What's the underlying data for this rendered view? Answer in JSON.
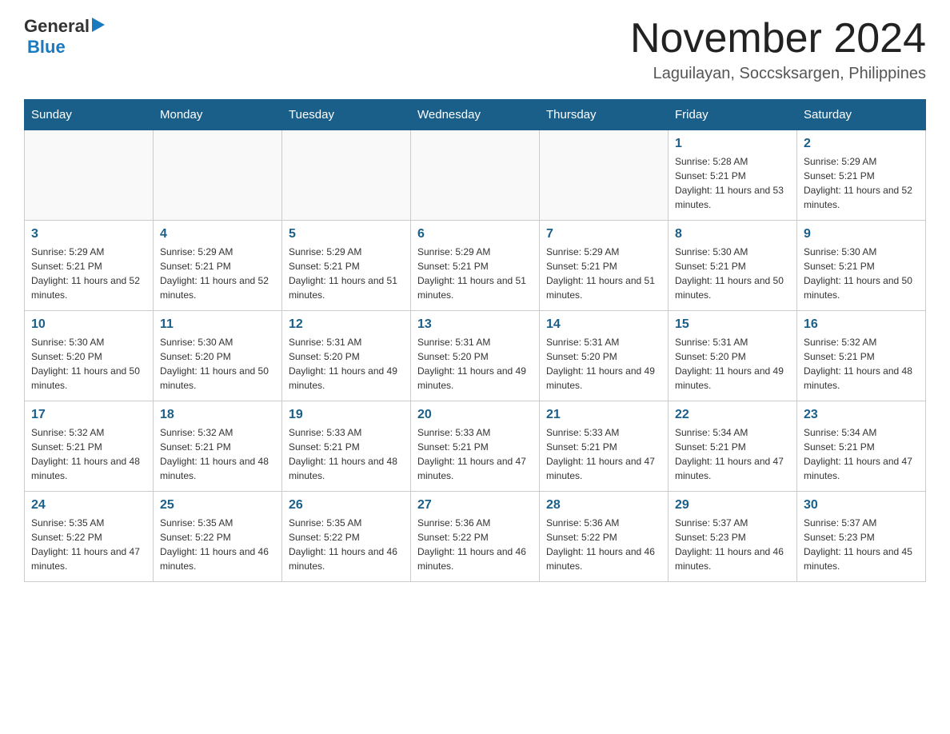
{
  "header": {
    "logo": {
      "general": "General",
      "blue": "Blue"
    },
    "title": "November 2024",
    "location": "Laguilayan, Soccsksargen, Philippines"
  },
  "calendar": {
    "days_of_week": [
      "Sunday",
      "Monday",
      "Tuesday",
      "Wednesday",
      "Thursday",
      "Friday",
      "Saturday"
    ],
    "weeks": [
      [
        {
          "day": "",
          "info": ""
        },
        {
          "day": "",
          "info": ""
        },
        {
          "day": "",
          "info": ""
        },
        {
          "day": "",
          "info": ""
        },
        {
          "day": "",
          "info": ""
        },
        {
          "day": "1",
          "info": "Sunrise: 5:28 AM\nSunset: 5:21 PM\nDaylight: 11 hours and 53 minutes."
        },
        {
          "day": "2",
          "info": "Sunrise: 5:29 AM\nSunset: 5:21 PM\nDaylight: 11 hours and 52 minutes."
        }
      ],
      [
        {
          "day": "3",
          "info": "Sunrise: 5:29 AM\nSunset: 5:21 PM\nDaylight: 11 hours and 52 minutes."
        },
        {
          "day": "4",
          "info": "Sunrise: 5:29 AM\nSunset: 5:21 PM\nDaylight: 11 hours and 52 minutes."
        },
        {
          "day": "5",
          "info": "Sunrise: 5:29 AM\nSunset: 5:21 PM\nDaylight: 11 hours and 51 minutes."
        },
        {
          "day": "6",
          "info": "Sunrise: 5:29 AM\nSunset: 5:21 PM\nDaylight: 11 hours and 51 minutes."
        },
        {
          "day": "7",
          "info": "Sunrise: 5:29 AM\nSunset: 5:21 PM\nDaylight: 11 hours and 51 minutes."
        },
        {
          "day": "8",
          "info": "Sunrise: 5:30 AM\nSunset: 5:21 PM\nDaylight: 11 hours and 50 minutes."
        },
        {
          "day": "9",
          "info": "Sunrise: 5:30 AM\nSunset: 5:21 PM\nDaylight: 11 hours and 50 minutes."
        }
      ],
      [
        {
          "day": "10",
          "info": "Sunrise: 5:30 AM\nSunset: 5:20 PM\nDaylight: 11 hours and 50 minutes."
        },
        {
          "day": "11",
          "info": "Sunrise: 5:30 AM\nSunset: 5:20 PM\nDaylight: 11 hours and 50 minutes."
        },
        {
          "day": "12",
          "info": "Sunrise: 5:31 AM\nSunset: 5:20 PM\nDaylight: 11 hours and 49 minutes."
        },
        {
          "day": "13",
          "info": "Sunrise: 5:31 AM\nSunset: 5:20 PM\nDaylight: 11 hours and 49 minutes."
        },
        {
          "day": "14",
          "info": "Sunrise: 5:31 AM\nSunset: 5:20 PM\nDaylight: 11 hours and 49 minutes."
        },
        {
          "day": "15",
          "info": "Sunrise: 5:31 AM\nSunset: 5:20 PM\nDaylight: 11 hours and 49 minutes."
        },
        {
          "day": "16",
          "info": "Sunrise: 5:32 AM\nSunset: 5:21 PM\nDaylight: 11 hours and 48 minutes."
        }
      ],
      [
        {
          "day": "17",
          "info": "Sunrise: 5:32 AM\nSunset: 5:21 PM\nDaylight: 11 hours and 48 minutes."
        },
        {
          "day": "18",
          "info": "Sunrise: 5:32 AM\nSunset: 5:21 PM\nDaylight: 11 hours and 48 minutes."
        },
        {
          "day": "19",
          "info": "Sunrise: 5:33 AM\nSunset: 5:21 PM\nDaylight: 11 hours and 48 minutes."
        },
        {
          "day": "20",
          "info": "Sunrise: 5:33 AM\nSunset: 5:21 PM\nDaylight: 11 hours and 47 minutes."
        },
        {
          "day": "21",
          "info": "Sunrise: 5:33 AM\nSunset: 5:21 PM\nDaylight: 11 hours and 47 minutes."
        },
        {
          "day": "22",
          "info": "Sunrise: 5:34 AM\nSunset: 5:21 PM\nDaylight: 11 hours and 47 minutes."
        },
        {
          "day": "23",
          "info": "Sunrise: 5:34 AM\nSunset: 5:21 PM\nDaylight: 11 hours and 47 minutes."
        }
      ],
      [
        {
          "day": "24",
          "info": "Sunrise: 5:35 AM\nSunset: 5:22 PM\nDaylight: 11 hours and 47 minutes."
        },
        {
          "day": "25",
          "info": "Sunrise: 5:35 AM\nSunset: 5:22 PM\nDaylight: 11 hours and 46 minutes."
        },
        {
          "day": "26",
          "info": "Sunrise: 5:35 AM\nSunset: 5:22 PM\nDaylight: 11 hours and 46 minutes."
        },
        {
          "day": "27",
          "info": "Sunrise: 5:36 AM\nSunset: 5:22 PM\nDaylight: 11 hours and 46 minutes."
        },
        {
          "day": "28",
          "info": "Sunrise: 5:36 AM\nSunset: 5:22 PM\nDaylight: 11 hours and 46 minutes."
        },
        {
          "day": "29",
          "info": "Sunrise: 5:37 AM\nSunset: 5:23 PM\nDaylight: 11 hours and 46 minutes."
        },
        {
          "day": "30",
          "info": "Sunrise: 5:37 AM\nSunset: 5:23 PM\nDaylight: 11 hours and 45 minutes."
        }
      ]
    ]
  }
}
